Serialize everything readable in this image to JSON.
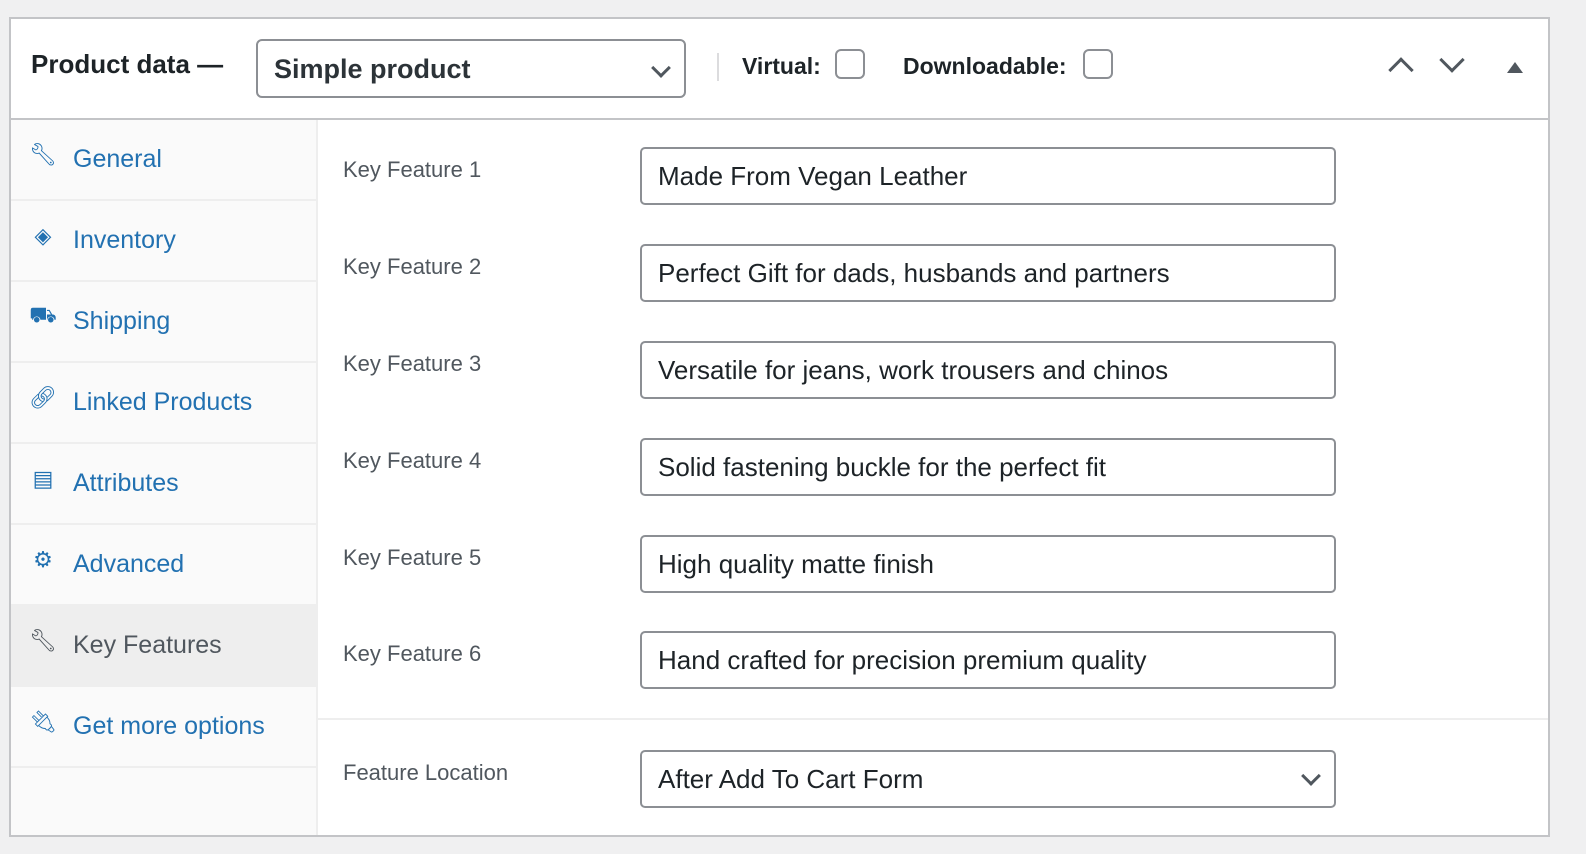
{
  "header": {
    "title": "Product data —",
    "product_type": "Simple product",
    "virtual_label": "Virtual:",
    "downloadable_label": "Downloadable:",
    "virtual_checked": false,
    "downloadable_checked": false
  },
  "tabs": [
    {
      "label": "General",
      "icon": "wrench-icon"
    },
    {
      "label": "Inventory",
      "icon": "tag-icon"
    },
    {
      "label": "Shipping",
      "icon": "truck-icon"
    },
    {
      "label": "Linked Products",
      "icon": "link-icon"
    },
    {
      "label": "Attributes",
      "icon": "list-icon"
    },
    {
      "label": "Advanced",
      "icon": "gear-icon"
    },
    {
      "label": "Key Features",
      "icon": "wrench-icon",
      "active": true
    },
    {
      "label": "Get more options",
      "icon": "plug-icon"
    }
  ],
  "fields": [
    {
      "label": "Key Feature 1",
      "value": "Made From Vegan Leather"
    },
    {
      "label": "Key Feature 2",
      "value": "Perfect Gift for dads, husbands and partners"
    },
    {
      "label": "Key Feature 3",
      "value": "Versatile for jeans, work trousers and chinos"
    },
    {
      "label": "Key Feature 4",
      "value": "Solid fastening buckle for the perfect fit"
    },
    {
      "label": "Key Feature 5",
      "value": "High quality matte finish"
    },
    {
      "label": "Key Feature 6",
      "value": "Hand crafted for precision premium quality"
    }
  ],
  "location": {
    "label": "Feature Location",
    "value": "After Add To Cart Form"
  },
  "colors": {
    "link": "#2271b1",
    "active_bg": "#eeeeee"
  }
}
